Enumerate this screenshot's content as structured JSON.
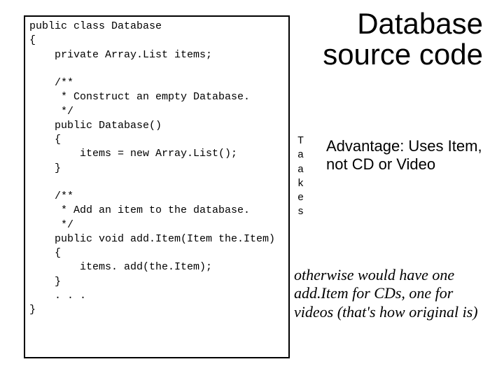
{
  "title_line1": "Database",
  "title_line2": "source code",
  "code": "public class Database\n{\n    private Array.List items;\n\n    /**\n     * Construct an empty Database.\n     */\n    public Database()\n    {\n        items = new Array.List();\n    }\n\n    /**\n     * Add an item to the database.\n     */\n    public void add.Item(Item the.Item)\n    {\n        items. add(the.Item);\n    }\n    . . .\n}",
  "vertical_word": "T\na\na\nk\ne\ns",
  "advantage": "Advantage: Uses Item, not CD or Video",
  "note": "otherwise would have one add.Item for CDs, one for videos (that's how original is)"
}
